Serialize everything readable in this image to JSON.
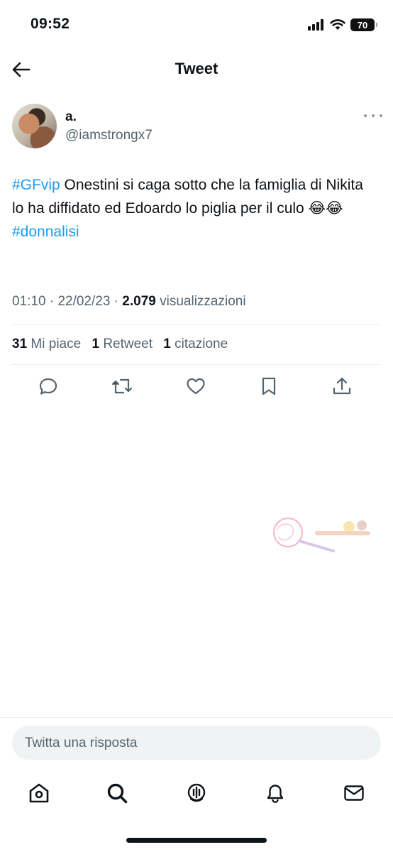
{
  "status_bar": {
    "time": "09:52",
    "battery_level": "70",
    "signal_icon": "cellular-signal-icon",
    "wifi_icon": "wifi-icon"
  },
  "header": {
    "title": "Tweet",
    "back_icon": "arrow-left-icon"
  },
  "tweet": {
    "author": {
      "display_name": "a.",
      "handle": "@iamstrongx7"
    },
    "text_parts": {
      "hashtag_1": "#GFvip",
      "body": " Onestini si caga sotto che la famiglia di Nikita lo ha diffidato ed Edoardo lo piglia per il culo 😂😂",
      "hashtag_2": "#donnalisi"
    },
    "meta": {
      "time": "01:10",
      "separator": " · ",
      "date": "22/02/23",
      "views_count": "2.079",
      "views_label": " visualizzazioni"
    },
    "stats": {
      "likes_count": "31",
      "likes_label": "Mi piace",
      "retweets_count": "1",
      "retweets_label": "Retweet",
      "quotes_count": "1",
      "quotes_label": "citazione"
    }
  },
  "actions": [
    "reply-icon",
    "retweet-icon",
    "like-icon",
    "bookmark-icon",
    "share-icon"
  ],
  "reply": {
    "placeholder": "Twitta una risposta"
  },
  "tab_bar": [
    "home-icon",
    "search-icon",
    "spaces-icon",
    "notifications-icon",
    "messages-icon"
  ],
  "colors": {
    "accent": "#1d9bf0",
    "secondary_text": "#536471",
    "primary_text": "#0f1419"
  }
}
